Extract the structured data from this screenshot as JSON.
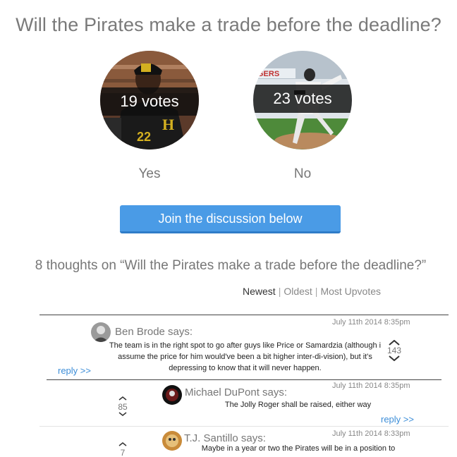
{
  "poll": {
    "question": "Will the Pirates make a trade before the deadline?",
    "options": [
      {
        "label": "Yes",
        "votes": "19 votes"
      },
      {
        "label": "No",
        "votes": "23 votes"
      }
    ],
    "join_button": "Join the discussion below"
  },
  "comments_section": {
    "heading": "8 thoughts on “Will the Pirates make a trade before the deadline?”",
    "sort": {
      "newest": "Newest",
      "oldest": "Oldest",
      "most_upvotes": "Most Upvotes",
      "separator": "|"
    }
  },
  "comments": [
    {
      "author": "Ben Brode says:",
      "date": "July 11th 2014 8:35pm",
      "text": "The team is in the right spot to go after guys like Price or Samardzia (although i assume the price for him would've been a bit higher inter-di-vision), but it's depressing to know that it will never happen.",
      "votes": "143",
      "reply": "reply >>"
    },
    {
      "author": "Michael DuPont says:",
      "date": "July 11th 2014 8:35pm",
      "text": "The Jolly Roger shall be raised, either way",
      "votes": "85",
      "reply": "reply >>"
    },
    {
      "author": "T.J. Santillo says:",
      "date": "July 11th 2014 8:33pm",
      "text": "Maybe in a year or two the Pirates will be in a position to",
      "votes": "7",
      "reply": ""
    }
  ]
}
